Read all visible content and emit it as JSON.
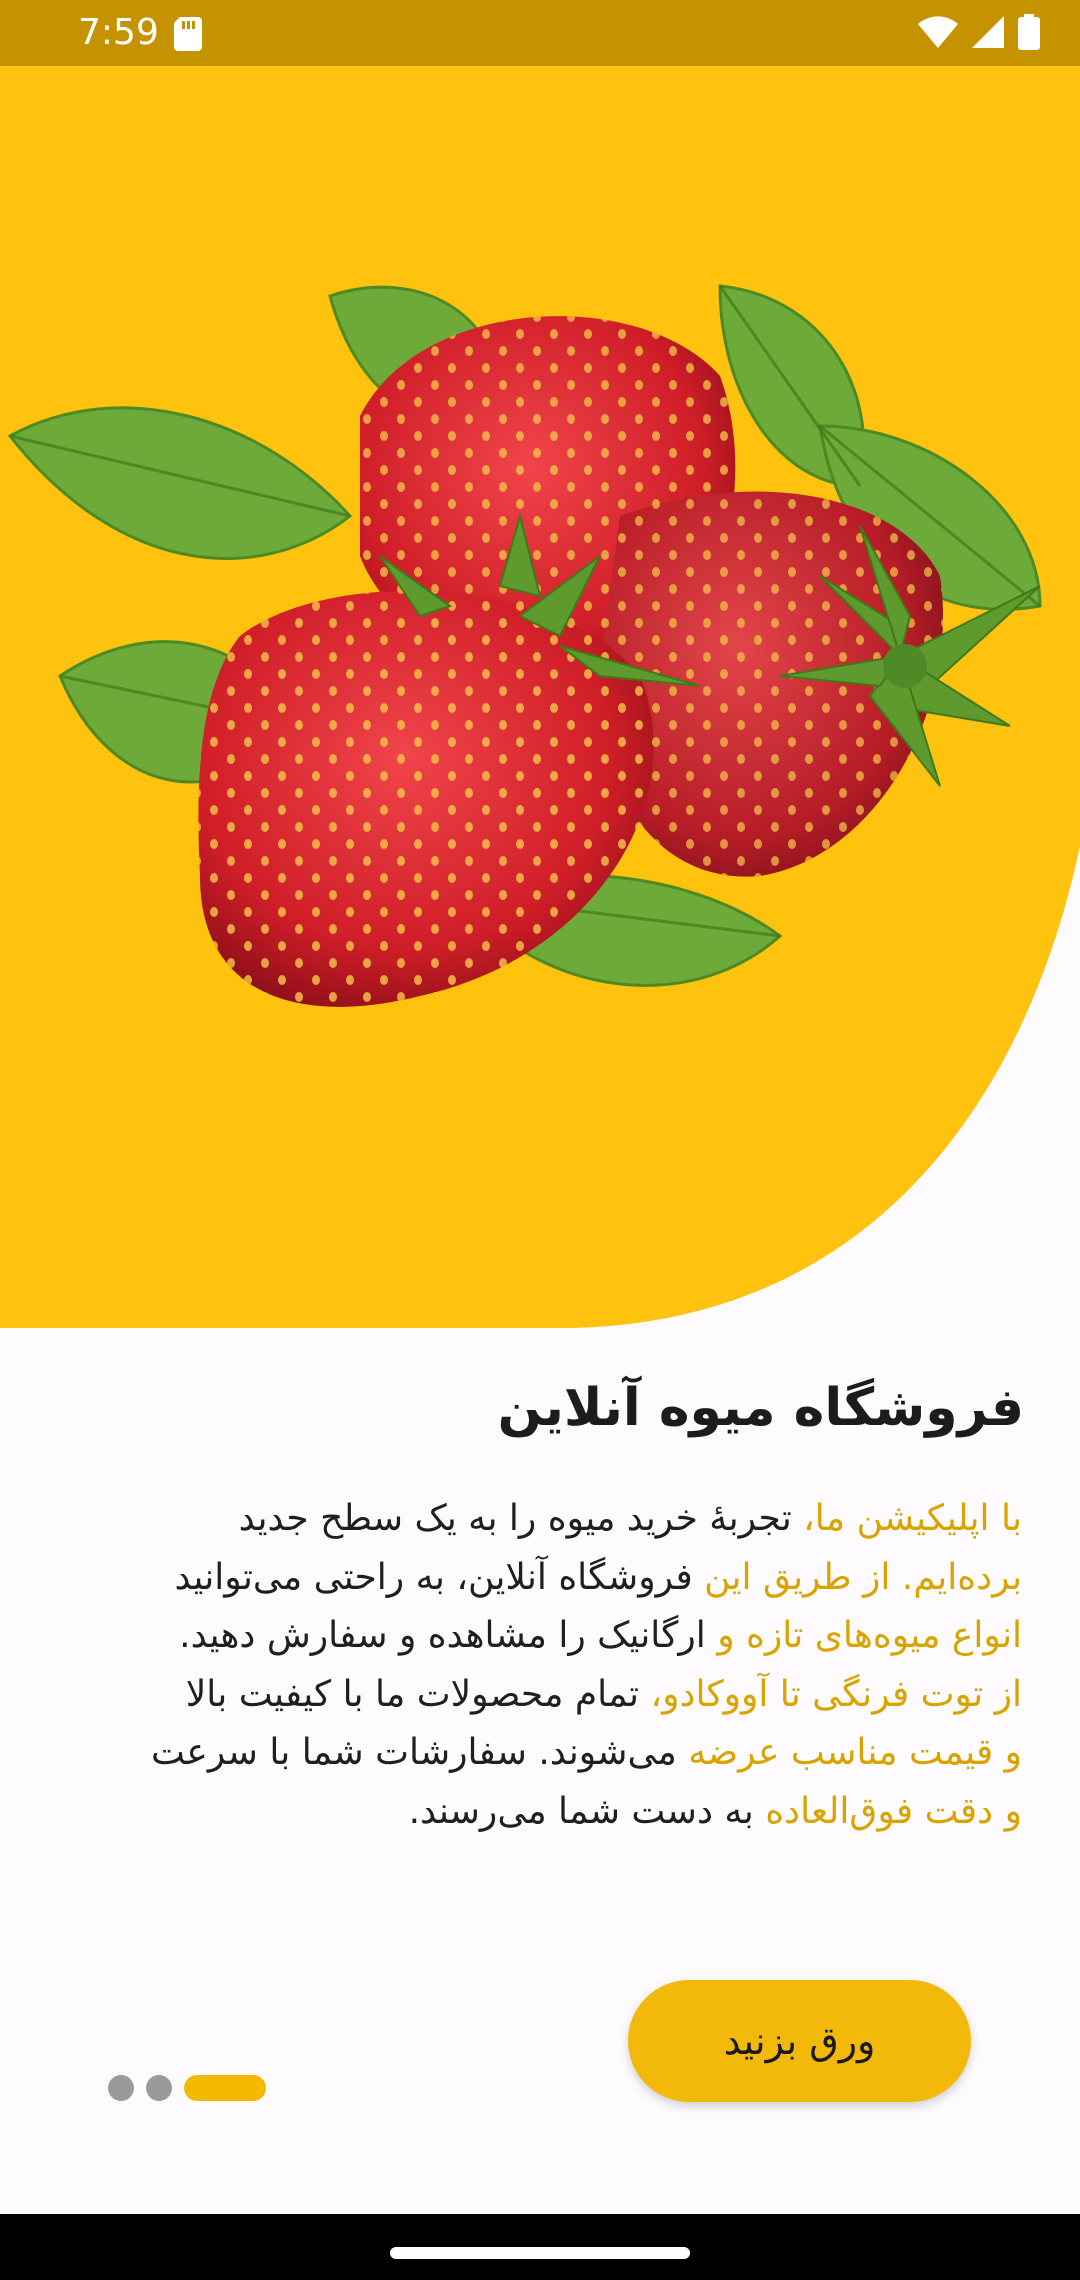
{
  "status_bar": {
    "time": "7:59",
    "icons": [
      "sd-card-icon",
      "wifi-icon",
      "signal-icon",
      "battery-icon"
    ]
  },
  "hero": {
    "background_color": "#FFC20E",
    "illustration": "strawberries-image"
  },
  "content": {
    "title": "فروشگاه میوه آنلاین",
    "description_lines": [
      [
        {
          "text": "با اپلیکیشن ما، ",
          "highlight": true
        },
        {
          "text": "تجربهٔ خرید میوه را به یک سطح جدید",
          "highlight": false
        }
      ],
      [
        {
          "text": "برده‌ایم. از طریق این ",
          "highlight": true
        },
        {
          "text": "فروشگاه آنلاین، به راحتی می‌توانید",
          "highlight": false
        }
      ],
      [
        {
          "text": "انواع میوه‌های تازه و ",
          "highlight": true
        },
        {
          "text": "ارگانیک را مشاهده و سفارش دهید.",
          "highlight": false
        }
      ],
      [
        {
          "text": "از توت فرنگی تا آووکادو، ",
          "highlight": true
        },
        {
          "text": "تمام محصولات ما با کیفیت بالا",
          "highlight": false
        }
      ],
      [
        {
          "text": "و قیمت مناسب عرضه ",
          "highlight": true
        },
        {
          "text": "می‌شوند. سفارشات شما با سرعت",
          "highlight": false
        }
      ],
      [
        {
          "text": "و دقت فوق‌العاده ",
          "highlight": true
        },
        {
          "text": "به دست شما می‌رسند.",
          "highlight": false
        }
      ]
    ]
  },
  "pager": {
    "count": 3,
    "active_index": 2,
    "active_color": "#F5B800",
    "inactive_color": "#9A9A9A"
  },
  "button": {
    "label": "ورق بزنید",
    "color": "#F3B90A"
  }
}
